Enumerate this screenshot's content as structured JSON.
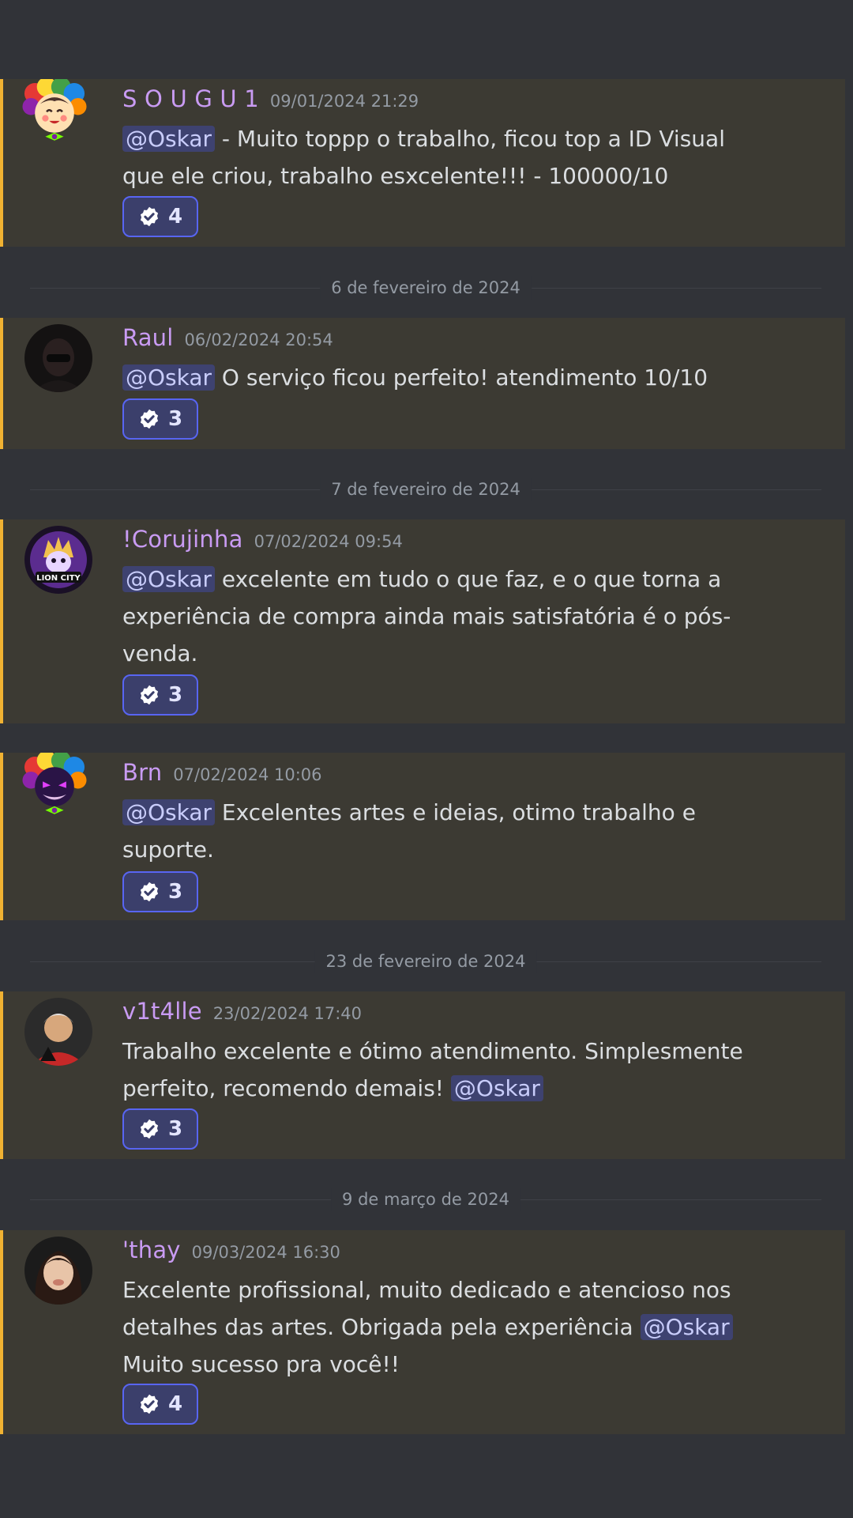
{
  "accent_color": "#f0b232",
  "mention_color": "#5865f2",
  "messages": [
    {
      "username": "S O U G U 1",
      "timestamp": "09/01/2024 21:29",
      "avatar_icon": "clown-wig-emoji-avatar",
      "line1_mention": "@Oskar",
      "line1_text": " - Muito toppp o trabalho, ficou top a ID Visual",
      "line2_text": "que ele criou, trabalho esxcelente!!! - 100000/10",
      "reaction_icon": "verified-check-icon",
      "reaction_count": "4"
    },
    {
      "username": "Raul",
      "timestamp": "06/02/2024 20:54",
      "avatar_icon": "dark-hooded-avatar",
      "line1_mention": "@Oskar",
      "line1_text": " O serviço ficou perfeito! atendimento 10/10",
      "reaction_icon": "verified-check-icon",
      "reaction_count": "3"
    },
    {
      "username": "!Corujinha",
      "timestamp": "07/02/2024 09:54",
      "avatar_icon": "lion-city-logo-avatar",
      "avatar_text": "LION CITY",
      "line1_mention": "@Oskar",
      "line1_text": " excelente em tudo o que faz, e o que torna a",
      "line2_text": "experiência de compra ainda mais satisfatória é o pós-",
      "line3_text": "venda.",
      "reaction_icon": "verified-check-icon",
      "reaction_count": "3"
    },
    {
      "username": "Brn",
      "timestamp": "07/02/2024 10:06",
      "avatar_icon": "clown-wig-monster-avatar",
      "line1_mention": "@Oskar",
      "line1_text": " Excelentes artes e ideias, otimo trabalho e",
      "line2_text": "suporte.",
      "reaction_icon": "verified-check-icon",
      "reaction_count": "3"
    },
    {
      "username": "v1t4lle",
      "timestamp": "23/02/2024 17:40",
      "avatar_icon": "person-photo-avatar",
      "line1_text": "Trabalho excelente e ótimo atendimento. Simplesmente",
      "line2_text": "perfeito, recomendo demais! ",
      "line2_mention": "@Oskar",
      "reaction_icon": "verified-check-icon",
      "reaction_count": "3"
    },
    {
      "username": "'thay",
      "timestamp": "09/03/2024 16:30",
      "avatar_icon": "person-photo-avatar",
      "line1_text": "Excelente profissional, muito dedicado e atencioso nos",
      "line2_text": "detalhes das artes. Obrigada pela experiência ",
      "line2_mention": "@Oskar",
      "line3_text": "Muito sucesso pra você!!",
      "reaction_icon": "verified-check-icon",
      "reaction_count": "4"
    }
  ],
  "dividers": [
    "6 de fevereiro de 2024",
    "7 de fevereiro de 2024",
    "23 de fevereiro de 2024",
    "9 de março de 2024"
  ]
}
